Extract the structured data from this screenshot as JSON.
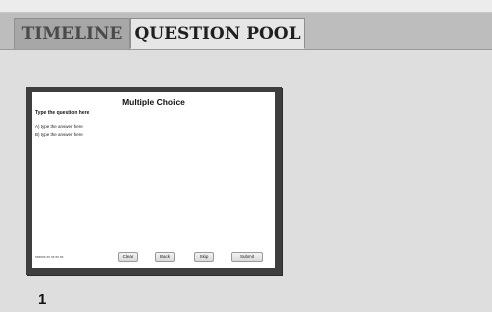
{
  "tabs": [
    {
      "label": "TIMELINE"
    },
    {
      "label": "QUESTION POOL"
    }
  ],
  "thumbnail": {
    "title": "Multiple Choice",
    "question": "Type the question here",
    "answers": [
      {
        "bullet": "A)",
        "text": "A) type the answer here"
      },
      {
        "bullet": "B)",
        "text": "B) type the answer here"
      }
    ],
    "footer_text": "xxxxxx xx xx xx xx",
    "buttons": {
      "clear": "Clear",
      "back": "Back",
      "skip": "Skip",
      "submit": "Submit"
    },
    "number": "1"
  }
}
